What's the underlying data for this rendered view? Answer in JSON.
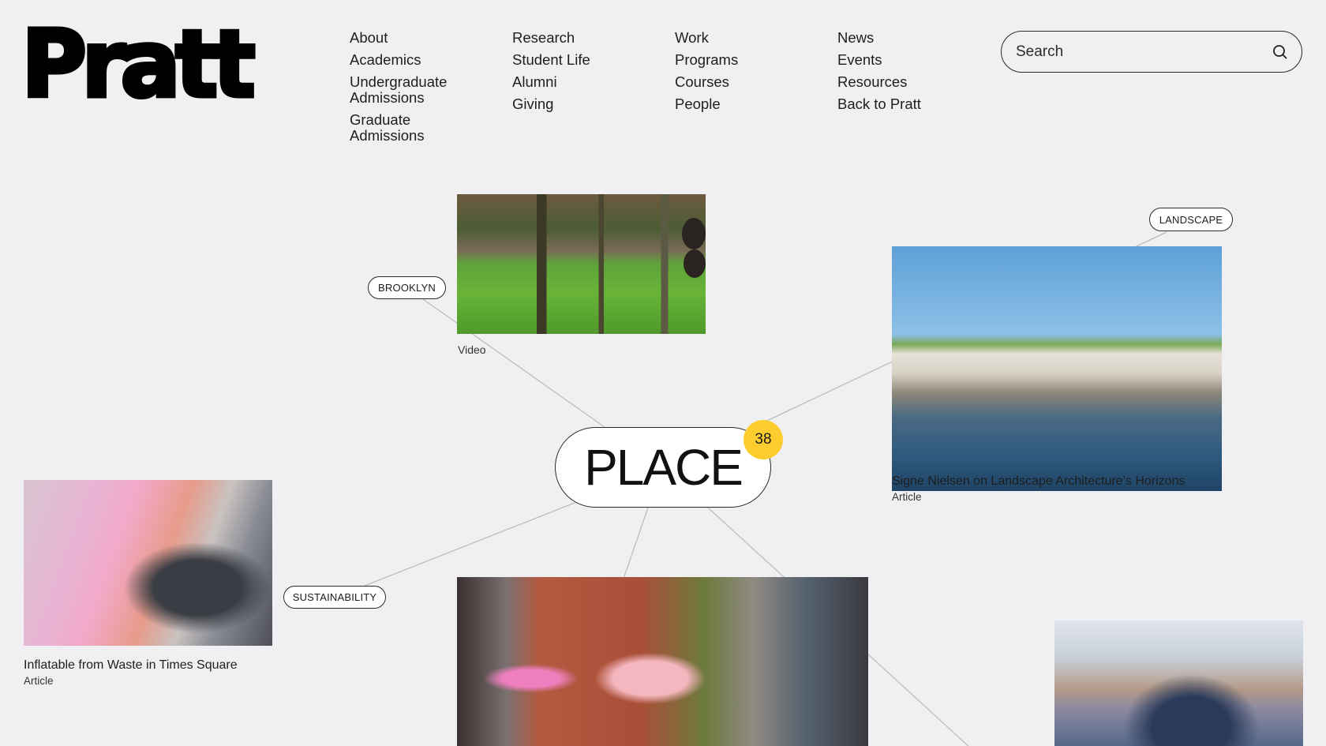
{
  "logo": {
    "text": "Pratt"
  },
  "nav": {
    "columns": [
      {
        "items": [
          "About",
          "Academics",
          "Undergraduate Admissions",
          "Graduate Admissions"
        ]
      },
      {
        "items": [
          "Research",
          "Student Life",
          "Alumni",
          "Giving"
        ]
      },
      {
        "items": [
          "Work",
          "Programs",
          "Courses",
          "People"
        ]
      },
      {
        "items": [
          "News",
          "Events",
          "Resources",
          "Back to Pratt"
        ]
      }
    ]
  },
  "search": {
    "placeholder": "Search",
    "value": "",
    "icon": "search-icon"
  },
  "hub": {
    "label": "PLACE",
    "count": "38",
    "badge_color": "#fdcd30"
  },
  "tags": {
    "brooklyn": "BROOKLYN",
    "landscape": "LANDSCAPE",
    "sustainability": "SUSTAINABILITY"
  },
  "cards": {
    "park": {
      "type": "Video",
      "image": "students sitting on lawn among trees"
    },
    "landscape": {
      "title": "Signe Nielsen on Landscape Architecture’s Horizons",
      "type": "Article",
      "image": "concrete pier park with trees over water"
    },
    "inflatable": {
      "title": "Inflatable from Waste in Times Square",
      "type": "Article",
      "image": "pink inflatable structure in Times Square"
    },
    "fashion": {
      "image": "fashion runway show outdoors"
    },
    "bridge": {
      "image": "students walking on Brooklyn Bridge"
    }
  }
}
